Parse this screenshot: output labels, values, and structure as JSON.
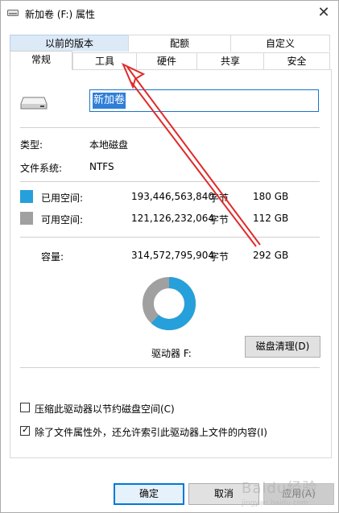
{
  "window": {
    "title": "新加卷 (F:) 属性",
    "close_glyph": "✕"
  },
  "tabs_row1": [
    {
      "label": "以前的版本",
      "highlighted": true
    },
    {
      "label": "配额"
    },
    {
      "label": "自定义"
    }
  ],
  "tabs_row2": [
    {
      "label": "常规",
      "active": true
    },
    {
      "label": "工具"
    },
    {
      "label": "硬件"
    },
    {
      "label": "共享"
    },
    {
      "label": "安全"
    }
  ],
  "general": {
    "icon": "drive-icon",
    "volume_name": "新加卷",
    "type_label": "类型:",
    "type_value": "本地磁盘",
    "fs_label": "文件系统:",
    "fs_value": "NTFS",
    "used": {
      "label": "已用空间:",
      "bytes": "193,446,563,840",
      "unit": "字节",
      "gb": "180 GB",
      "color": "#26a0da"
    },
    "free": {
      "label": "可用空间:",
      "bytes": "121,126,232,064",
      "unit": "字节",
      "gb": "112 GB",
      "color": "#a0a0a0"
    },
    "capacity": {
      "label": "容量:",
      "bytes": "314,572,795,904",
      "unit": "字节",
      "gb": "292 GB"
    },
    "drive_label": "驱动器 F:",
    "cleanup_button": "磁盘清理(D)",
    "used_fraction": 0.6165
  },
  "options": {
    "compress": {
      "label": "压缩此驱动器以节约磁盘空间(C)",
      "checked": false
    },
    "index": {
      "label": "除了文件属性外，还允许索引此驱动器上文件的内容(I)",
      "checked": true,
      "check_glyph": "✓"
    }
  },
  "footer": {
    "ok": "确定",
    "cancel": "取消",
    "apply": "应用(A)"
  },
  "watermark": {
    "main": "Baidu经验",
    "sub": "jingyan.baidu.com"
  }
}
